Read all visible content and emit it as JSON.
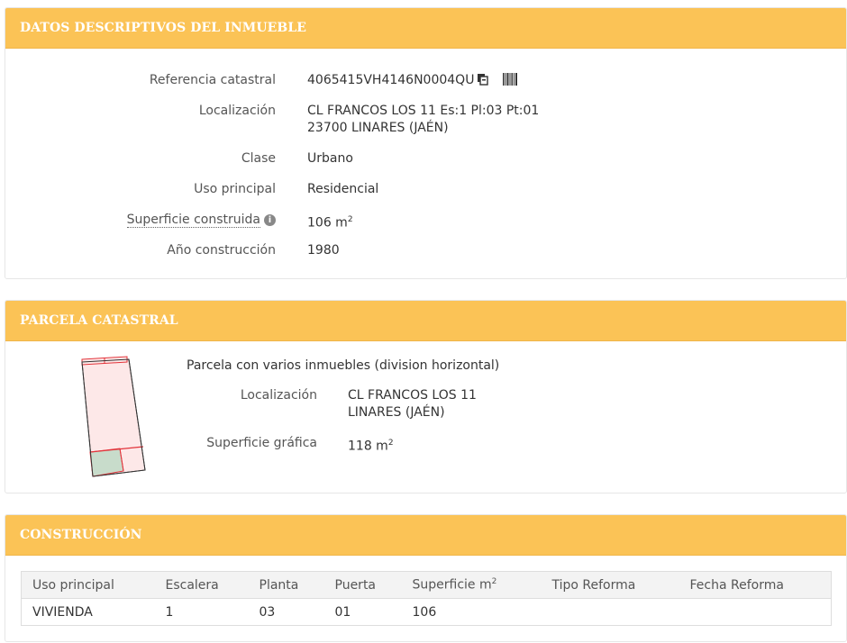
{
  "datos": {
    "title": "DATOS DESCRIPTIVOS DEL INMUEBLE",
    "referencia_label": "Referencia catastral",
    "referencia_value": "4065415VH4146N0004QU",
    "localizacion_label": "Localización",
    "localizacion_line1": "CL FRANCOS LOS 11 Es:1 Pl:03 Pt:01",
    "localizacion_line2": "23700 LINARES (JAÉN)",
    "clase_label": "Clase",
    "clase_value": "Urbano",
    "uso_label": "Uso principal",
    "uso_value": "Residencial",
    "superficie_label": "Superficie construida",
    "superficie_value": "106 m",
    "superficie_unit_sup": "2",
    "anio_label": "Año construcción",
    "anio_value": "1980"
  },
  "parcela": {
    "title": "PARCELA CATASTRAL",
    "descripcion": "Parcela con varios inmuebles (division horizontal)",
    "localizacion_label": "Localización",
    "localizacion_line1": "CL FRANCOS LOS 11",
    "localizacion_line2": "LINARES (JAÉN)",
    "superficie_label": "Superficie gráfica",
    "superficie_value": "118 m",
    "superficie_unit_sup": "2"
  },
  "construccion": {
    "title": "CONSTRUCCIÓN",
    "columns": [
      "Uso principal",
      "Escalera",
      "Planta",
      "Puerta",
      "Superficie m",
      "Tipo Reforma",
      "Fecha Reforma"
    ],
    "superficie_col_sup": "2",
    "rows": [
      [
        "VIVIENDA",
        "1",
        "03",
        "01",
        "106",
        "",
        ""
      ]
    ]
  },
  "colors": {
    "header_bg": "#fbc356",
    "parcel_fill": "#fde8e8",
    "parcel_stroke": "#e2333a",
    "highlight_fill": "#c8dccb"
  },
  "icons": [
    "copy-icon",
    "barcode-icon",
    "info-icon"
  ]
}
